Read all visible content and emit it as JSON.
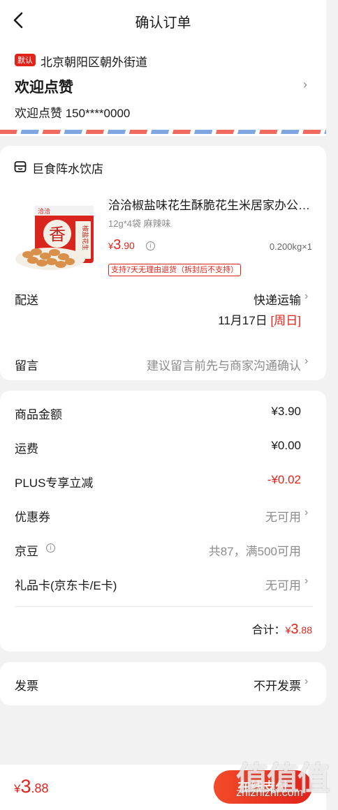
{
  "header": {
    "title": "确认订单"
  },
  "address": {
    "default_tag": "默认",
    "region": "北京朝阳区朝外街道",
    "detail": "欢迎点赞",
    "contact": "欢迎点赞 150****0000"
  },
  "shop": {
    "name": "巨食阵水饮店",
    "product": {
      "title": "洽洽椒盐味花生酥脆花生米居家办公零食",
      "spec": "12g*4袋 麻辣味",
      "price_symbol": "¥",
      "price_int": "3",
      "price_dec": ".90",
      "weight": "0.200kg×1",
      "return_tag": "支持7天无理由退货（拆封后不支持）",
      "image_logo": "洽洽",
      "image_text": "香",
      "image_pack_text": "椒盐花生"
    },
    "delivery": {
      "label": "配送",
      "method": "快递运输",
      "date": "11月17日",
      "weekday": "[周日]"
    },
    "note": {
      "label": "留言",
      "placeholder": "建议留言前先与商家沟通确认"
    }
  },
  "fees": {
    "goods_label": "商品金额",
    "goods_value": "¥3.90",
    "shipping_label": "运费",
    "shipping_value": "¥0.00",
    "plus_label": "PLUS专享立减",
    "plus_value": "-¥0.02",
    "coupon_label": "优惠券",
    "coupon_value": "无可用",
    "jingdou_label": "京豆",
    "jingdou_value": "共87，满500可用",
    "giftcard_label": "礼品卡(京东卡/E卡)",
    "giftcard_value": "无可用",
    "total_label": "合计：",
    "total_symbol": "¥",
    "total_int": "3",
    "total_dec": ".88"
  },
  "invoice": {
    "label": "发票",
    "value": "不开发票"
  },
  "bottom": {
    "price_symbol": "¥",
    "price_int": "3",
    "price_dec": ".88",
    "pay_label": "在线支付"
  },
  "watermark": {
    "main": "值值值",
    "sub": "zhizhizhi.com"
  },
  "colors": {
    "accent": "#e2231a",
    "muted": "#8c8c8c",
    "background": "#f2f2f2"
  }
}
